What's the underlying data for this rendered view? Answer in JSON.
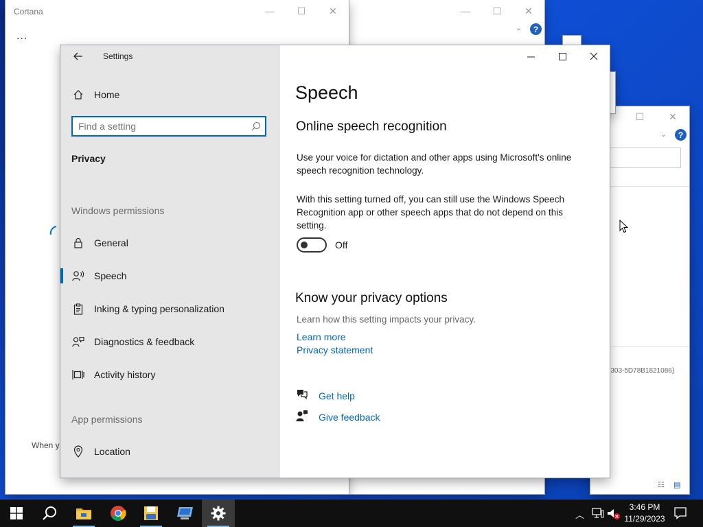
{
  "cortana": {
    "title": "Cortana",
    "more": "...",
    "partial_text": "When y"
  },
  "background_window": {
    "guid_text": "}303-5D78B1821086}"
  },
  "settings": {
    "app_title": "Settings",
    "home": "Home",
    "search_placeholder": "Find a setting",
    "category": "Privacy",
    "section_windows": "Windows permissions",
    "section_app": "App permissions",
    "nav": [
      {
        "label": "General"
      },
      {
        "label": "Speech"
      },
      {
        "label": "Inking & typing personalization"
      },
      {
        "label": "Diagnostics & feedback"
      },
      {
        "label": "Activity history"
      },
      {
        "label": "Location"
      }
    ],
    "page_title": "Speech",
    "subheading": "Online speech recognition",
    "desc1": "Use your voice for dictation and other apps using Microsoft's online speech recognition technology.",
    "desc2": "With this setting turned off, you can still use the Windows Speech Recognition app or other speech apps that do not depend on this setting.",
    "toggle_state": "Off",
    "privacy_heading": "Know your privacy options",
    "privacy_desc": "Learn how this setting impacts your privacy.",
    "learn_more": "Learn more",
    "privacy_statement": "Privacy statement",
    "get_help": "Get help",
    "give_feedback": "Give feedback"
  },
  "taskbar": {
    "time": "3:46 PM",
    "date": "11/29/2023"
  },
  "colors": {
    "accent": "#0067c0",
    "taskbar": "#101010"
  }
}
